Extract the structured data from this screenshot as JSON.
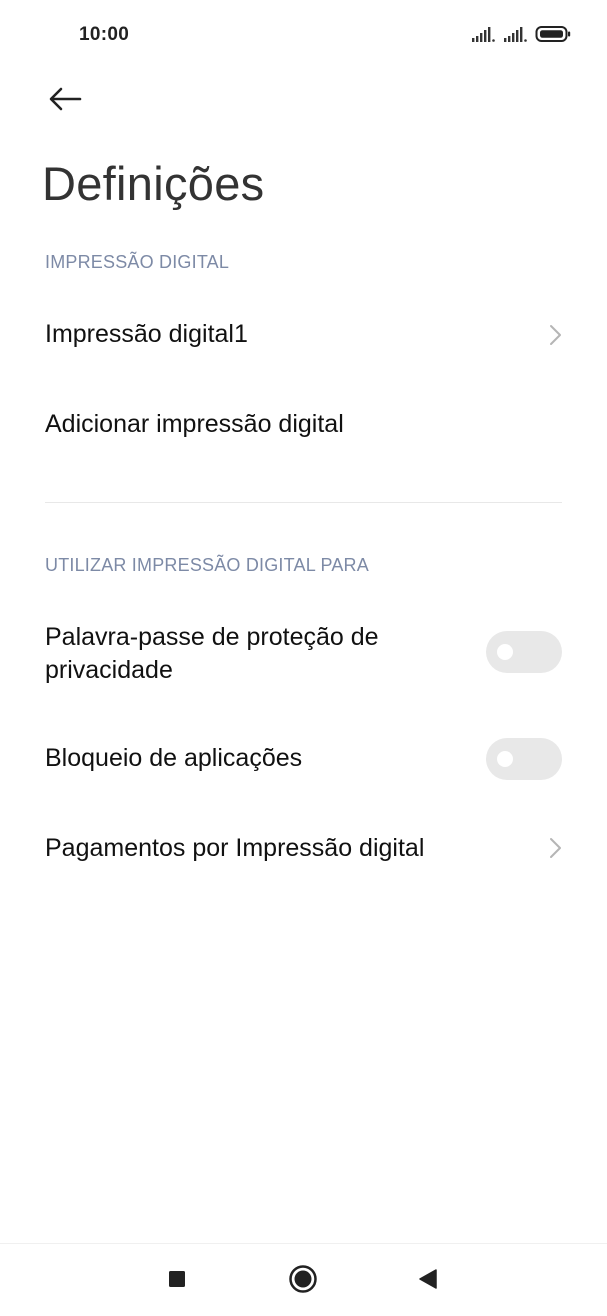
{
  "status_bar": {
    "time": "10:00",
    "icons": [
      "signal-icon",
      "signal-icon",
      "battery-icon"
    ]
  },
  "header": {
    "back_icon": "back-arrow-icon",
    "title": "Definições"
  },
  "sections": [
    {
      "header": "IMPRESSÃO DIGITAL",
      "items": [
        {
          "label": "Impressão digital1",
          "type": "chevron"
        },
        {
          "label": "Adicionar impressão digital",
          "type": "action"
        }
      ]
    },
    {
      "header": "UTILIZAR IMPRESSÃO DIGITAL PARA",
      "items": [
        {
          "label": "Palavra-passe de proteção de privacidade",
          "type": "toggle",
          "enabled": false
        },
        {
          "label": "Bloqueio de aplicações",
          "type": "toggle",
          "enabled": false
        },
        {
          "label": "Pagamentos por Impressão digital",
          "type": "chevron"
        }
      ]
    }
  ],
  "nav_bar": {
    "icons": [
      "recents-square-icon",
      "home-circle-icon",
      "back-triangle-icon"
    ]
  },
  "colors": {
    "section_header": "#7d8aa6",
    "toggle_off": "#e8e8e8",
    "text_primary": "#111111"
  }
}
